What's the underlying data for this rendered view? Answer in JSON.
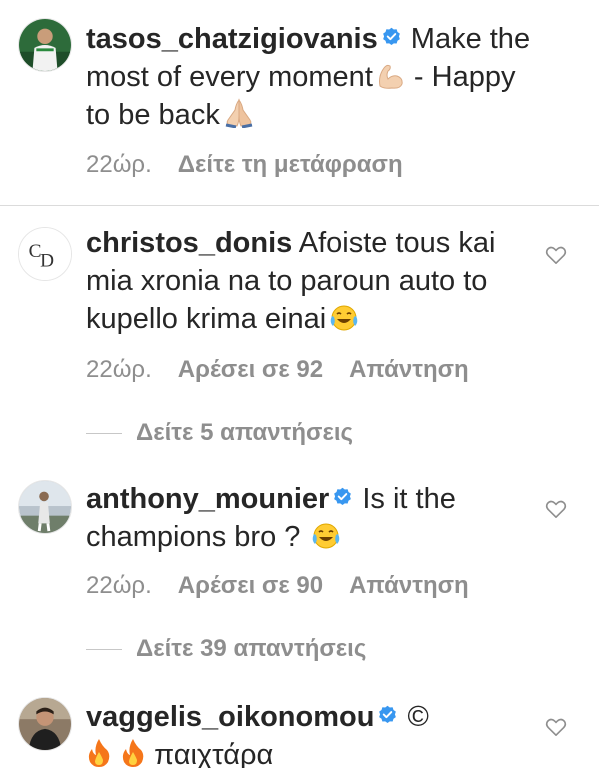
{
  "caption": {
    "username": "tasos_chatzigiovanis",
    "text_before_emoji": "Make the most of every moment",
    "emoji_1": "flexed-biceps",
    "text_middle": " - Happy to be back",
    "emoji_2": "folded-hands",
    "time": "22ώρ.",
    "translate_label": "Δείτε τη μετάφραση"
  },
  "comments": [
    {
      "username": "christos_donis",
      "verified": false,
      "text": "Afoiste tous kai mia xronia na to paroun auto to kupello krima einai",
      "emoji": "face-with-tears-of-joy",
      "time": "22ώρ.",
      "likes_label": "Αρέσει σε 92",
      "reply_label": "Απάντηση",
      "view_replies_label": "Δείτε 5 απαντήσεις"
    },
    {
      "username": "anthony_mounier",
      "verified": true,
      "text": "Is it the champions bro ?",
      "emoji": "face-with-tears-of-joy",
      "time": "22ώρ.",
      "likes_label": "Αρέσει σε 90",
      "reply_label": "Απάντηση",
      "view_replies_label": "Δείτε 39 απαντήσεις"
    },
    {
      "username": "vaggelis_oikonomou",
      "verified": true,
      "text_symbol": "©",
      "emoji": "fire",
      "text": "παιχτάρα"
    }
  ],
  "colors": {
    "text": "#262626",
    "secondary": "#8e8e8e",
    "verified_blue": "#3897f0",
    "divider": "#dbdbdb"
  },
  "icons": {
    "heart": "heart-outline-icon",
    "verified": "verified-badge-icon"
  }
}
